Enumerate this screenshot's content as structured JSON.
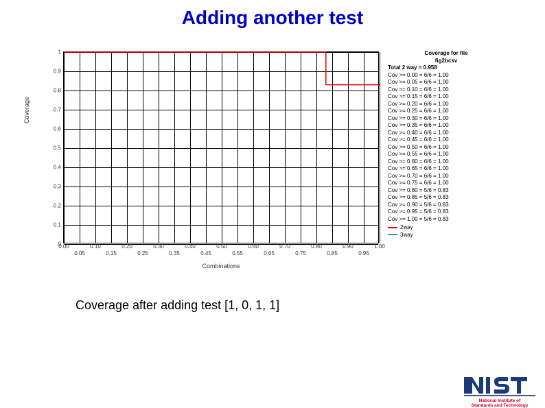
{
  "title": "Adding another test",
  "caption": "Coverage after adding test [1, 0, 1, 1]",
  "side_header1": "Coverage for file",
  "side_header2": "fig2bcsv",
  "side_total": "Total 2 way = 0.958",
  "side_rows": [
    "Cov >= 0.00 = 6/6 = 1.00",
    "Cov >= 0.05 = 6/6 = 1.00",
    "Cov >= 0.10 = 6/6 = 1.00",
    "Cov >= 0.15 = 6/6 = 1.00",
    "Cov >= 0.20 = 6/6 = 1.00",
    "Cov >= 0.25 = 6/6 = 1.00",
    "Cov >= 0.30 = 6/6 = 1.00",
    "Cov >= 0.35 = 6/6 = 1.00",
    "Cov >= 0.40 = 6/6 = 1.00",
    "Cov >= 0.45 = 6/6 = 1.00",
    "Cov >= 0.50 = 6/6 = 1.00",
    "Cov >= 0.55 = 6/6 = 1.00",
    "Cov >= 0.60 = 6/6 = 1.00",
    "Cov >= 0.65 = 6/6 = 1.00",
    "Cov >= 0.70 = 6/6 = 1.00",
    "Cov >= 0.75 = 6/6 = 1.00",
    "Cov >= 0.80 = 5/6 = 0.83",
    "Cov >= 0.85 = 5/6 = 0.83",
    "Cov >= 0.90 = 5/6 = 0.83",
    "Cov >= 0.95 = 5/6 = 0.83",
    "Cov >= 1.00 = 5/6 = 0.83"
  ],
  "legend_items": [
    {
      "label": "2way",
      "color": "#e60000"
    },
    {
      "label": "3way",
      "color": "#2aa36b"
    }
  ],
  "logo_sub1": "National Institute of",
  "logo_sub2": "Standards and Technology",
  "chart_data": {
    "type": "line",
    "title": "",
    "xlabel": "Combinations",
    "ylabel": "Coverage",
    "xlim": [
      0.0,
      1.0
    ],
    "ylim": [
      0.0,
      1.0
    ],
    "xticks": [
      0.0,
      0.05,
      0.1,
      0.15,
      0.2,
      0.25,
      0.3,
      0.35,
      0.4,
      0.45,
      0.5,
      0.55,
      0.6,
      0.65,
      0.7,
      0.75,
      0.8,
      0.85,
      0.9,
      0.95,
      1.0
    ],
    "yticks": [
      0,
      0.1,
      0.2,
      0.3,
      0.4,
      0.5,
      0.6,
      0.7,
      0.8,
      0.9,
      1
    ],
    "series": [
      {
        "name": "2way",
        "color": "#e60000",
        "x": [
          0.0,
          0.75,
          0.75,
          0.83,
          0.83,
          1.0
        ],
        "y": [
          1.0,
          1.0,
          1.0,
          1.0,
          0.83,
          0.83
        ]
      }
    ]
  }
}
